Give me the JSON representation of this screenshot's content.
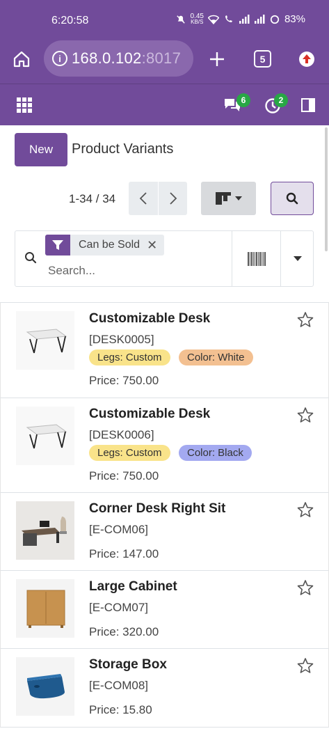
{
  "status_bar": {
    "time": "6:20:58",
    "net_speed_value": "0.45",
    "net_speed_unit": "KB/S",
    "battery": "83%"
  },
  "browser": {
    "url_host": "168.0.102",
    "url_port": ":8017",
    "tab_count": "5"
  },
  "navbar": {
    "messages_count": "6",
    "activities_count": "2"
  },
  "control_panel": {
    "new_label": "New",
    "title": "Product Variants",
    "pager_value": "1-34 / 34"
  },
  "search": {
    "facet_label": "Can be Sold",
    "placeholder": "Search..."
  },
  "records": [
    {
      "name": "Customizable Desk",
      "ref": "[DESK0005]",
      "tags": [
        {
          "label": "Legs: Custom",
          "color": "#f9e38a"
        },
        {
          "label": "Color: White",
          "color": "#f3c091"
        }
      ],
      "price": "Price: 750.00",
      "image": "desk-white"
    },
    {
      "name": "Customizable Desk",
      "ref": "[DESK0006]",
      "tags": [
        {
          "label": "Legs: Custom",
          "color": "#f9e38a"
        },
        {
          "label": "Color: Black",
          "color": "#a3a9f0"
        }
      ],
      "price": "Price: 750.00",
      "image": "desk-black"
    },
    {
      "name": "Corner Desk Right Sit",
      "ref": "[E-COM06]",
      "tags": [],
      "price": "Price: 147.00",
      "image": "corner-desk"
    },
    {
      "name": "Large Cabinet",
      "ref": "[E-COM07]",
      "tags": [],
      "price": "Price: 320.00",
      "image": "cabinet"
    },
    {
      "name": "Storage Box",
      "ref": "[E-COM08]",
      "tags": [],
      "price": "Price: 15.80",
      "image": "storage-box"
    }
  ],
  "colors": {
    "brand": "#714b9a",
    "badge": "#28a745"
  }
}
